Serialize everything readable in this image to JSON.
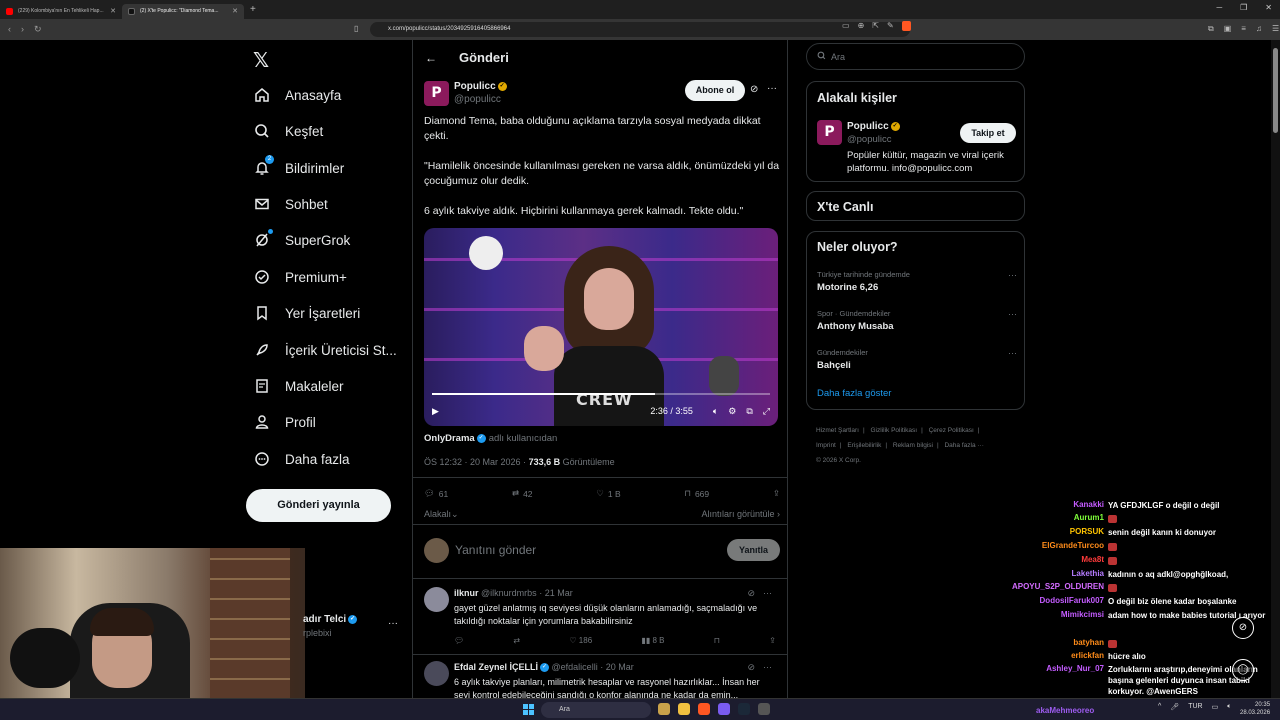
{
  "browser": {
    "tabs": [
      {
        "title": "(229) Kolombiya'nın En Tehlikeli Hap...",
        "favicon_color": "#ff0000"
      },
      {
        "title": "(2) X'te Populicc: \"Diamond Tema...",
        "favicon_color": "#111111"
      }
    ],
    "url": "x.com/populicc/status/2034925916405866964"
  },
  "nav": {
    "items": [
      {
        "label": "Anasayfa",
        "icon": "home-icon"
      },
      {
        "label": "Keşfet",
        "icon": "search-icon"
      },
      {
        "label": "Bildirimler",
        "icon": "bell-icon",
        "badge": "2"
      },
      {
        "label": "Sohbet",
        "icon": "mail-icon"
      },
      {
        "label": "SuperGrok",
        "icon": "grok-icon"
      },
      {
        "label": "Premium+",
        "icon": "premium-icon"
      },
      {
        "label": "Yer İşaretleri",
        "icon": "bookmark-icon"
      },
      {
        "label": "İçerik Üreticisi St...",
        "icon": "rocket-icon"
      },
      {
        "label": "Makaleler",
        "icon": "article-icon"
      },
      {
        "label": "Profil",
        "icon": "profile-icon"
      },
      {
        "label": "Daha fazla",
        "icon": "more-circle-icon"
      }
    ],
    "post_button": "Gönderi yayınla",
    "account_name": "adır Telci",
    "account_handle": "rplebixi"
  },
  "main": {
    "header_title": "Gönderi",
    "author": {
      "name": "Populicc",
      "handle": "@populicc",
      "avatar_letter": "P"
    },
    "subscribe_label": "Abone ol",
    "text": [
      "Diamond Tema, baba olduğunu açıklama tarzıyla sosyal medyada dikkat çekti.",
      "\"Hamilelik öncesinde kullanılması gereken ne varsa aldık, önümüzdeki yıl da çocuğumuz olur dedik.",
      "6 aylık takviye aldık. Hiçbirini kullanmaya gerek kalmadı. Tekte oldu.\""
    ],
    "video": {
      "time": "2:36 / 3:55",
      "progress": 0.66,
      "shirt_text": "CREW"
    },
    "source_name": "OnlyDrama",
    "source_suffix": "adlı kullanıcıdan",
    "timestamp": "ÖS 12:32 · 20 Mar 2026 ·",
    "views": "733,6 B",
    "views_label": "Görüntüleme",
    "stats": {
      "replies": "61",
      "reposts": "42",
      "likes": "1 B",
      "bookmarks": "669"
    },
    "sort_label": "Alakalı",
    "quotes_label": "Alıntıları görüntüle",
    "reply_placeholder": "Yanıtını gönder",
    "reply_button": "Yanıtla",
    "replies": [
      {
        "name": "ilknur",
        "handle": "@ilknurdmrbs",
        "date": "· 21 Mar",
        "text": "gayet güzel anlatmış ıq seviyesi düşük olanların anlamadığı, saçmaladığı ve takıldığı noktalar için yorumlara bakabilirsiniz",
        "likes": "186",
        "views": "8 B"
      },
      {
        "name": "Efdal Zeynel İÇELLİ",
        "handle": "@efdalicelli",
        "date": "· 20 Mar",
        "text": "6 aylık takviye planları, milimetrik hesaplar ve rasyonel hazırlıklar... İnsan her şeyi kontrol edebileceğini sandığı o konfor alanında ne kadar da emin..."
      }
    ]
  },
  "right": {
    "search_placeholder": "Ara",
    "related_title": "Alakalı kişiler",
    "related": {
      "name": "Populicc",
      "handle": "@populicc",
      "follow": "Takip et",
      "bio": "Popüler kültür, magazin ve viral içerik platformu. info@populicc.com"
    },
    "live_title": "X'te Canlı",
    "trends_title": "Neler oluyor?",
    "trends": [
      {
        "category": "Türkiye tarihinde gündemde",
        "name": "Motorine 6,26"
      },
      {
        "category": "Spor · Gündemdekiler",
        "name": "Anthony Musaba"
      },
      {
        "category": "Gündemdekiler",
        "name": "Bahçeli"
      }
    ],
    "show_more": "Daha fazla göster",
    "footer": [
      "Hizmet Şartları",
      "|",
      "Gizlilik Politikası",
      "|",
      "Çerez Politikası",
      "|",
      "Imprint",
      "|",
      "Erişilebilirlik",
      "|",
      "Reklam bilgisi",
      "|",
      "Daha fazla ···",
      "© 2026 X Corp."
    ]
  },
  "chat": [
    {
      "user": "Kanakki",
      "color": "#c45cff",
      "msg": "YA GFDJKLGF o değil o değil"
    },
    {
      "user": "Aurum1",
      "color": "#7fff3a",
      "msg": ""
    },
    {
      "user": "PORSUK",
      "color": "#ffc400",
      "msg": "senin değil kanın ki donuyor"
    },
    {
      "user": "ElGrandeTurcoo",
      "color": "#ff8c1a",
      "msg": ""
    },
    {
      "user": "Mea8t",
      "color": "#ff3b3b",
      "msg": ""
    },
    {
      "user": "Lakethia",
      "color": "#b57cff",
      "msg": "kadının o aq adkl@opghğlkoad,"
    },
    {
      "user": "APOYU_S2P_OLDUREN",
      "color": "#d36bff",
      "msg": ""
    },
    {
      "user": "DodosilFaruk007",
      "color": "#c45cff",
      "msg": "O değil biz ölene kadar boşalanke"
    },
    {
      "user": "Mimikcimsi",
      "color": "#c45cff",
      "msg": "adam how to make babies tutorial ı arıyor"
    },
    {
      "user": "batyhan",
      "color": "#ff8c1a",
      "msg": ""
    },
    {
      "user": "erlickfan",
      "color": "#ff8c1a",
      "msg": "hücre alıo"
    },
    {
      "user": "Ashley_Nur_07",
      "color": "#c45cff",
      "msg": "Zorluklarını araştırıp,deneyimi olanların başına gelenleri duyunca insan tabiki korkuyor. @AwenGERS"
    }
  ],
  "taskbar": {
    "search": "Ara",
    "streamer": "akaMehmeoreo",
    "lang": "TUR",
    "time": "20:35",
    "date": "28.03.2026"
  }
}
